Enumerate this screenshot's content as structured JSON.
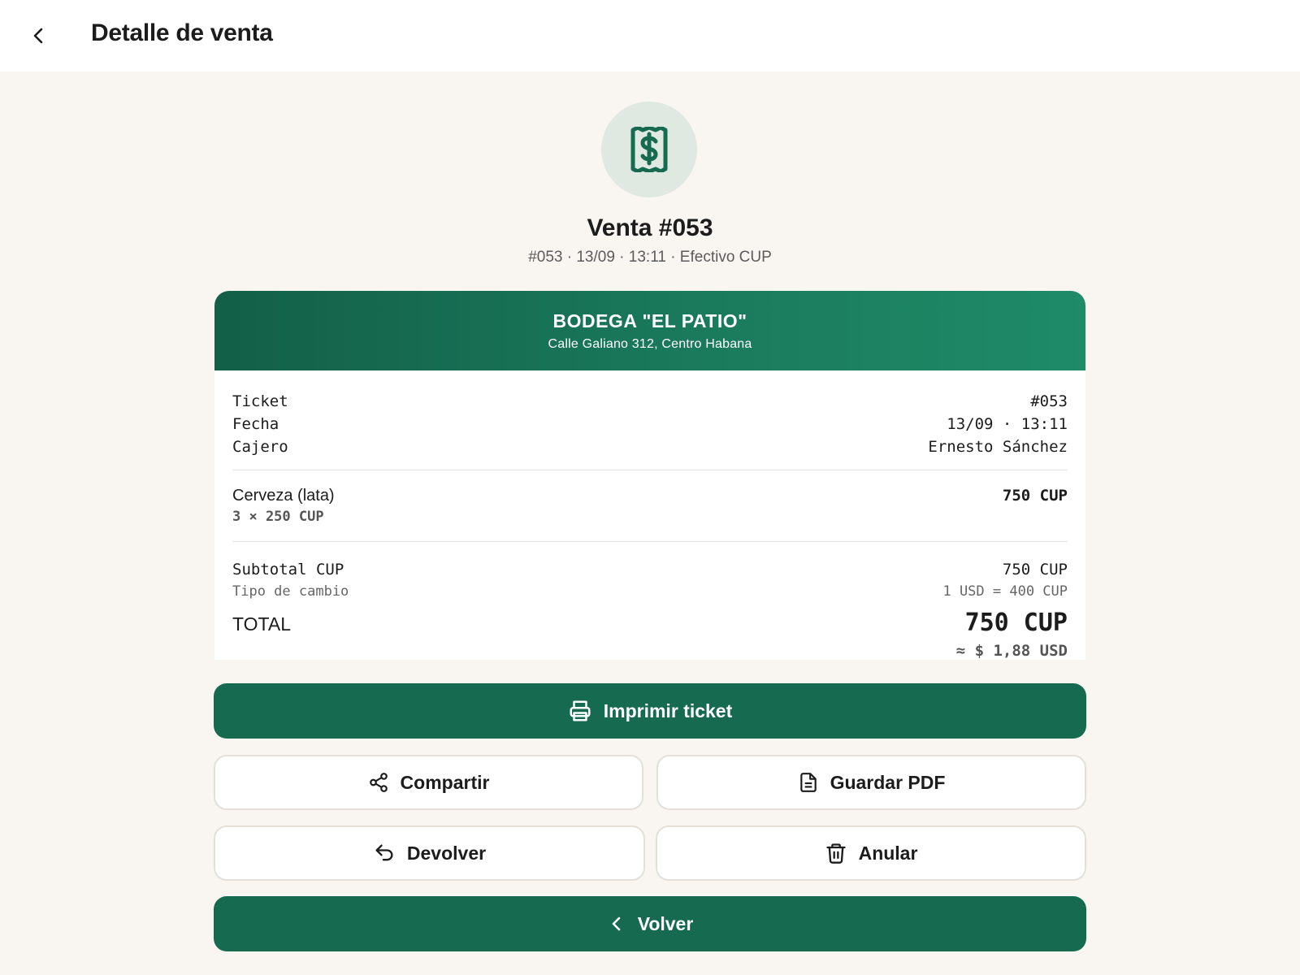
{
  "header": {
    "title": "Detalle de venta"
  },
  "hero": {
    "title": "Venta #053",
    "meta": "#053 · 13/09 · 13:11 · Efectivo CUP"
  },
  "receipt": {
    "store_name": "BODEGA \"EL PATIO\"",
    "store_address": "Calle Galiano 312, Centro Habana",
    "info": [
      {
        "label": "Ticket",
        "value": "#053"
      },
      {
        "label": "Fecha",
        "value": "13/09 · 13:11"
      },
      {
        "label": "Cajero",
        "value": "Ernesto Sánchez"
      }
    ],
    "items": [
      {
        "name": "Cerveza (lata)",
        "qty": "3 × 250 CUP",
        "total": "750 CUP"
      }
    ],
    "subtotal_label": "Subtotal CUP",
    "subtotal_value": "750 CUP",
    "rate_label": "Tipo de cambio",
    "rate_value": "1 USD = 400 CUP",
    "total_label": "TOTAL",
    "total_value": "750 CUP",
    "total_usd": "≈ $ 1,88 USD"
  },
  "actions": {
    "print": "Imprimir ticket",
    "share": "Compartir",
    "pdf": "Guardar PDF",
    "refund": "Devolver",
    "void": "Anular",
    "back": "Volver"
  },
  "colors": {
    "primary": "#156a50",
    "background": "#f9f6f1",
    "icon_circle": "#dfe9e2"
  },
  "icons": {
    "back": "chevron-left-icon",
    "hero": "receipt-dollar-icon",
    "print": "printer-icon",
    "share": "share-icon",
    "pdf": "document-icon",
    "refund": "undo-icon",
    "void": "trash-icon",
    "volver": "chevron-left-icon"
  }
}
